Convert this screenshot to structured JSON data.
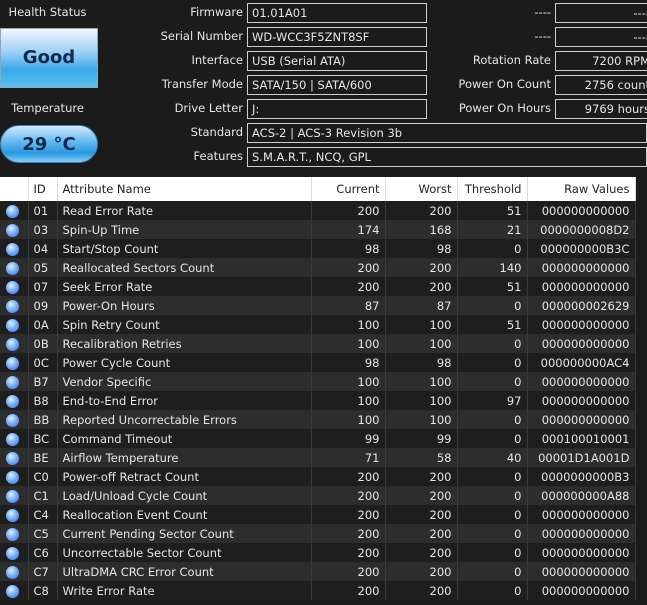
{
  "health": {
    "title": "Health Status",
    "status": "Good",
    "temp_title": "Temperature",
    "temp": "29 °C"
  },
  "info": {
    "firmware": {
      "label": "Firmware",
      "value": "01.01A01"
    },
    "serial": {
      "label": "Serial Number",
      "value": "WD-WCC3F5ZNT8SF"
    },
    "interface": {
      "label": "Interface",
      "value": "USB (Serial ATA)"
    },
    "transfer": {
      "label": "Transfer Mode",
      "value": "SATA/150 | SATA/600"
    },
    "drive": {
      "label": "Drive Letter",
      "value": "J:"
    },
    "standard": {
      "label": "Standard",
      "value": "ACS-2 | ACS-3 Revision 3b"
    },
    "features": {
      "label": "Features",
      "value": "S.M.A.R.T., NCQ, GPL"
    },
    "r1": {
      "label": "----",
      "value": "----"
    },
    "r2": {
      "label": "----",
      "value": "----"
    },
    "rotation": {
      "label": "Rotation Rate",
      "value": "7200 RPM"
    },
    "pcount": {
      "label": "Power On Count",
      "value": "2756 count"
    },
    "phours": {
      "label": "Power On Hours",
      "value": "9769 hours"
    }
  },
  "table": {
    "headers": [
      "",
      "ID",
      "Attribute Name",
      "Current",
      "Worst",
      "Threshold",
      "Raw Values"
    ],
    "status_color": "#5a8cff",
    "rows": [
      [
        "01",
        "Read Error Rate",
        "200",
        "200",
        "51",
        "000000000000"
      ],
      [
        "03",
        "Spin-Up Time",
        "174",
        "168",
        "21",
        "0000000008D2"
      ],
      [
        "04",
        "Start/Stop Count",
        "98",
        "98",
        "0",
        "000000000B3C"
      ],
      [
        "05",
        "Reallocated Sectors Count",
        "200",
        "200",
        "140",
        "000000000000"
      ],
      [
        "07",
        "Seek Error Rate",
        "200",
        "200",
        "51",
        "000000000000"
      ],
      [
        "09",
        "Power-On Hours",
        "87",
        "87",
        "0",
        "000000002629"
      ],
      [
        "0A",
        "Spin Retry Count",
        "100",
        "100",
        "51",
        "000000000000"
      ],
      [
        "0B",
        "Recalibration Retries",
        "100",
        "100",
        "0",
        "000000000000"
      ],
      [
        "0C",
        "Power Cycle Count",
        "98",
        "98",
        "0",
        "000000000AC4"
      ],
      [
        "B7",
        "Vendor Specific",
        "100",
        "100",
        "0",
        "000000000000"
      ],
      [
        "B8",
        "End-to-End Error",
        "100",
        "100",
        "97",
        "000000000000"
      ],
      [
        "BB",
        "Reported Uncorrectable Errors",
        "100",
        "100",
        "0",
        "000000000000"
      ],
      [
        "BC",
        "Command Timeout",
        "99",
        "99",
        "0",
        "000100010001"
      ],
      [
        "BE",
        "Airflow Temperature",
        "71",
        "58",
        "40",
        "00001D1A001D"
      ],
      [
        "C0",
        "Power-off Retract Count",
        "200",
        "200",
        "0",
        "0000000000B3"
      ],
      [
        "C1",
        "Load/Unload Cycle Count",
        "200",
        "200",
        "0",
        "000000000A88"
      ],
      [
        "C4",
        "Reallocation Event Count",
        "200",
        "200",
        "0",
        "000000000000"
      ],
      [
        "C5",
        "Current Pending Sector Count",
        "200",
        "200",
        "0",
        "000000000000"
      ],
      [
        "C6",
        "Uncorrectable Sector Count",
        "200",
        "200",
        "0",
        "000000000000"
      ],
      [
        "C7",
        "UltraDMA CRC Error Count",
        "200",
        "200",
        "0",
        "000000000000"
      ],
      [
        "C8",
        "Write Error Rate",
        "200",
        "200",
        "0",
        "000000000000"
      ]
    ]
  }
}
